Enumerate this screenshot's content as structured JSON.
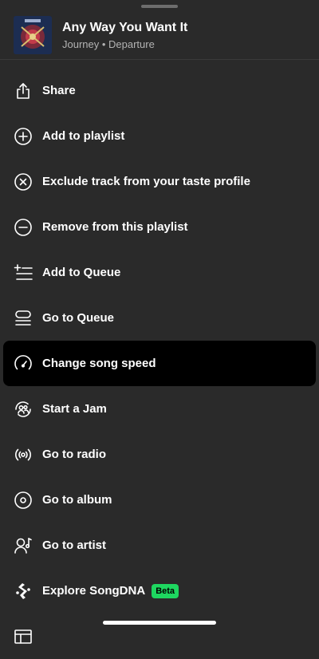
{
  "track": {
    "title": "Any Way You Want It",
    "subtitle": "Journey • Departure"
  },
  "menu": [
    {
      "label": "Share",
      "icon": "share-icon"
    },
    {
      "label": "Add to playlist",
      "icon": "add-circle-icon"
    },
    {
      "label": "Exclude track from your taste profile",
      "icon": "exclude-icon"
    },
    {
      "label": "Remove from this playlist",
      "icon": "remove-circle-icon"
    },
    {
      "label": "Add to Queue",
      "icon": "add-queue-icon"
    },
    {
      "label": "Go to Queue",
      "icon": "queue-icon"
    },
    {
      "label": "Change song speed",
      "icon": "speed-icon",
      "active": true
    },
    {
      "label": "Start a Jam",
      "icon": "jam-icon"
    },
    {
      "label": "Go to radio",
      "icon": "radio-icon"
    },
    {
      "label": "Go to album",
      "icon": "album-icon"
    },
    {
      "label": "Go to artist",
      "icon": "artist-icon"
    },
    {
      "label": "Explore SongDNA",
      "icon": "songdna-icon",
      "badge": "Beta"
    },
    {
      "label": "",
      "icon": "credits-icon"
    }
  ],
  "colors": {
    "background": "#2a2a2a",
    "highlight": "#000000",
    "badge": "#1ed760"
  }
}
